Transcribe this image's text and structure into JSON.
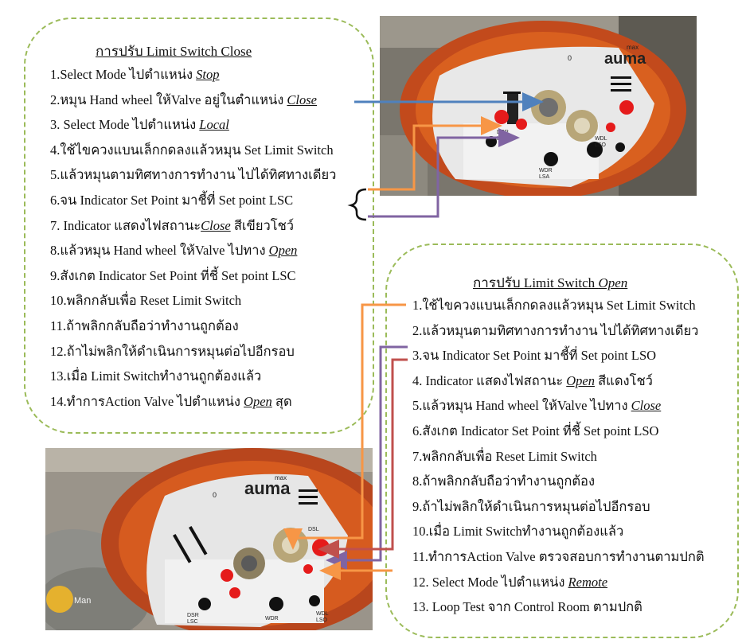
{
  "close_section": {
    "title": "การปรับ Limit Switch Close",
    "steps": [
      {
        "pre": "1.Select  Mode ไปตำแหน่ง ",
        "em": "Stop",
        "post": ""
      },
      {
        "pre": "2.หมุน Hand wheel ให้Valve อยู่ในตำแหน่ง ",
        "em": "Close",
        "post": ""
      },
      {
        "pre": "3. Select Mode ไปตำแหน่ง ",
        "em": "Local",
        "post": ""
      },
      {
        "pre": "4.ใช้ไขควงแบนเล็กกดลงแล้วหมุน Set Limit Switch",
        "em": "",
        "post": ""
      },
      {
        "pre": "5.แล้วหมุนตามทิศทางการทำงาน ไปได้ทิศทางเดียว",
        "em": "",
        "post": ""
      },
      {
        "pre": "6.จน Indicator Set Point มาชี้ที่ Set point   LSC",
        "em": "",
        "post": ""
      },
      {
        "pre": "7. Indicator แสดงไฟสถานะ",
        "em": "Close",
        "post": " สีเขียวโชว์"
      },
      {
        "pre": "8.แล้วหมุน Hand wheel ให้Valve  ไปทาง ",
        "em": "Open",
        "post": ""
      },
      {
        "pre": "9.สังเกต Indicator Set Point ที่ชี้ Set point   LSC",
        "em": "",
        "post": ""
      },
      {
        "pre": "10.พลิกกลับเพื่อ Reset Limit Switch",
        "em": "",
        "post": ""
      },
      {
        "pre": "11.ถ้าพลิกกลับถือว่าทำงานถูกต้อง",
        "em": "",
        "post": ""
      },
      {
        "pre": "12.ถ้าไม่พลิกให้ดำเนินการหมุนต่อไปอีกรอบ",
        "em": "",
        "post": ""
      },
      {
        "pre": "13.เมื่อ Limit Switchทำงานถูกต้องแล้ว",
        "em": "",
        "post": ""
      },
      {
        "pre": "14.ทำการAction Valve ไปตำแหน่ง ",
        "em": "Open",
        "post": " สุด"
      }
    ]
  },
  "open_section": {
    "title_pre": "การปรับ Limit Switch ",
    "title_em": "Open",
    "steps": [
      {
        "pre": "1.ใช้ไขควงแบนเล็กกดลงแล้วหมุน Set Limit Switch",
        "em": "",
        "post": ""
      },
      {
        "pre": "2.แล้วหมุนตามทิศทางการทำงาน ไปได้ทิศทางเดียว",
        "em": "",
        "post": ""
      },
      {
        "pre": "3.จน Indicator Set Point มาชี้ที่ Set point   LSO",
        "em": "",
        "post": ""
      },
      {
        "pre": "4. Indicator แสดงไฟสถานะ ",
        "em": "Open",
        "post": " สีแดงโชว์"
      },
      {
        "pre": "5.แล้วหมุน Hand wheel ให้Valve  ไปทาง ",
        "em": "Close",
        "post": ""
      },
      {
        "pre": "6.สังเกต Indicator Set Point ที่ชี้ Set point    LSO",
        "em": "",
        "post": ""
      },
      {
        "pre": "7.พลิกกลับเพื่อ Reset Limit Switch",
        "em": "",
        "post": ""
      },
      {
        "pre": "8.ถ้าพลิกกลับถือว่าทำงานถูกต้อง",
        "em": "",
        "post": ""
      },
      {
        "pre": "9.ถ้าไม่พลิกให้ดำเนินการหมุนต่อไปอีกรอบ",
        "em": "",
        "post": ""
      },
      {
        "pre": "10.เมื่อ Limit Switchทำงานถูกต้องแล้ว",
        "em": "",
        "post": ""
      },
      {
        "pre": "11.ทำการAction Valve ตรวจสอบการทำงานตามปกติ",
        "em": "",
        "post": ""
      },
      {
        "pre": "12. Select   Mode  ไปตำแหน่ง  ",
        "em": "Remote",
        "post": ""
      },
      {
        "pre": "13. Loop    Test จาก Control    Room ตามปกติ",
        "em": "",
        "post": ""
      }
    ]
  },
  "photo_labels": {
    "brand": "auma",
    "max": "max",
    "zero": "0",
    "dsr": "DSR",
    "lsc": "LSC",
    "wdr": "WDR",
    "lsa": "LSA",
    "wdl": "WDL",
    "lso": "LSO",
    "dsl": "DSL",
    "watermark": "Man"
  },
  "colors": {
    "blue_arrow": "#4f81bd",
    "orange_arrow": "#f79646",
    "purple_arrow": "#8064a2",
    "red_arrow": "#c0504d",
    "dashed_border": "#9bbb59"
  }
}
